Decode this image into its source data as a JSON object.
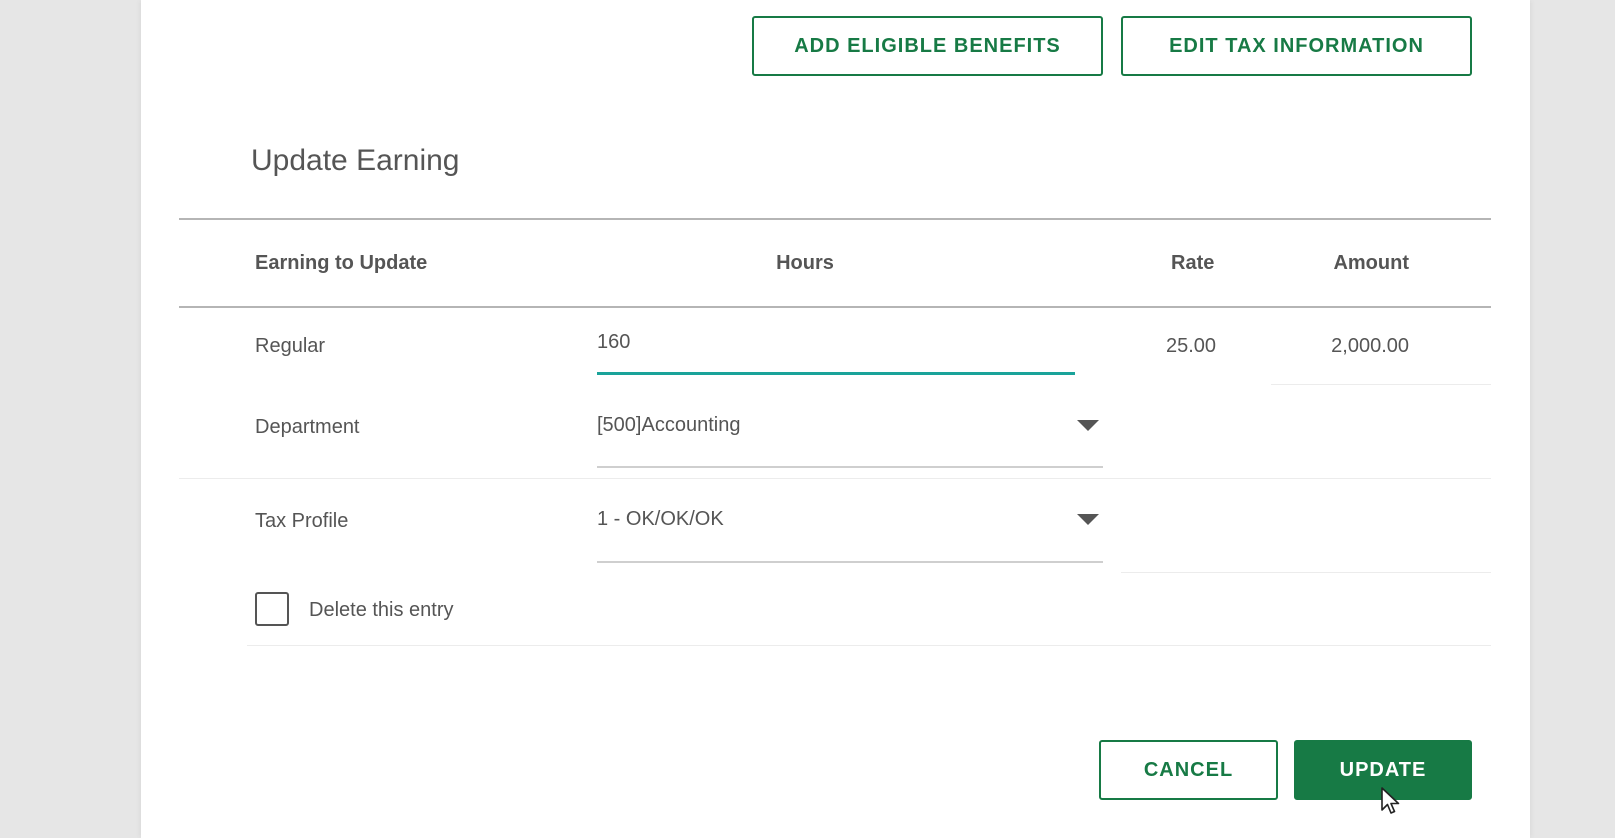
{
  "top_actions": {
    "add_benefits": "ADD ELIGIBLE BENEFITS",
    "edit_tax": "EDIT TAX INFORMATION"
  },
  "form": {
    "title": "Update Earning",
    "columns": {
      "earning": "Earning to Update",
      "hours": "Hours",
      "rate": "Rate",
      "amount": "Amount"
    },
    "row": {
      "label": "Regular",
      "hours_value": "160",
      "rate": "25.00",
      "amount": "2,000.00"
    },
    "department": {
      "label": "Department",
      "value": "[500]Accounting"
    },
    "tax_profile": {
      "label": "Tax Profile",
      "value": "1 - OK/OK/OK"
    },
    "delete_entry": {
      "label": "Delete this entry",
      "checked": false
    }
  },
  "footer": {
    "cancel": "CANCEL",
    "update": "UPDATE"
  },
  "colors": {
    "brand_green": "#177a45",
    "focus_teal": "#1aa39a"
  },
  "icons": {
    "dropdown": "caret-down-icon",
    "pointer": "mouse-pointer-icon"
  }
}
